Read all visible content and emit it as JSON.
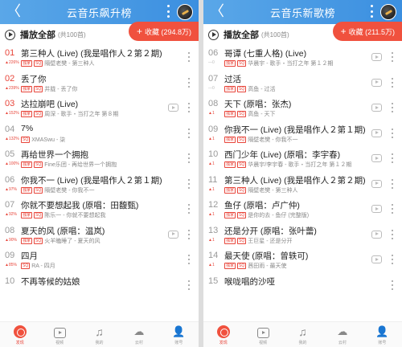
{
  "left": {
    "title": "云音乐飙升榜",
    "play_all": "播放全部",
    "count": "(共100首)",
    "collect": "收藏 (294.8万)",
    "rows": [
      {
        "rank": "01",
        "red": true,
        "trend": "▲226%",
        "title": "第三种人 (Live) (我是唱作人２第２期)",
        "tags": [
          "独家",
          "SQ"
        ],
        "sub": "隔壁老樊 - 第三种人",
        "mv": false
      },
      {
        "rank": "02",
        "red": true,
        "trend": "▲239%",
        "title": "丢了你",
        "tags": [
          "独家",
          "SQ"
        ],
        "sub": "井胧 - 丢了你",
        "mv": false
      },
      {
        "rank": "03",
        "red": true,
        "trend": "▲152%",
        "title": "达拉崩吧 (Live)",
        "tags": [
          "独家",
          "SQ"
        ],
        "sub": "周深 - 歌手・当打之年 第８期",
        "mv": true
      },
      {
        "rank": "04",
        "red": false,
        "trend": "▲132%",
        "title": "7%",
        "tags": [
          "SQ"
        ],
        "sub": "XMASwu - 柒",
        "mv": false
      },
      {
        "rank": "05",
        "red": false,
        "trend": "▲100%",
        "title": "再给世界一个拥抱",
        "tags": [
          "独家",
          "SQ"
        ],
        "sub": "Fine乐团 - 再给世界一个拥抱",
        "mv": false
      },
      {
        "rank": "06",
        "red": false,
        "trend": "▲97%",
        "title": "你我不一 (Live) (我是唱作人２第１期)",
        "tags": [
          "独家",
          "SQ"
        ],
        "sub": "隔壁老樊 - 你我不一",
        "mv": false
      },
      {
        "rank": "07",
        "red": false,
        "trend": "▲92%",
        "title": "你就不要想起我 (原唱：田馥甄)",
        "tags": [
          "独家",
          "SQ"
        ],
        "sub": "陈乐一 - 你就不要想起我",
        "mv": false
      },
      {
        "rank": "08",
        "red": false,
        "trend": "▲90%",
        "title": "夏天的风 (原唱：温岚)",
        "tags": [
          "独家",
          "SQ"
        ],
        "sub": "火羊瞌睡了 - 夏天的风",
        "mv": true
      },
      {
        "rank": "09",
        "red": false,
        "trend": "▲85%",
        "title": "四月",
        "tags": [
          "SQ"
        ],
        "sub": "RA - 四月",
        "mv": false
      },
      {
        "rank": "10",
        "red": false,
        "trend": "",
        "title": "不再等候的姑娘",
        "tags": [],
        "sub": "",
        "mv": false
      }
    ]
  },
  "right": {
    "title": "云音乐新歌榜",
    "play_all": "播放全部",
    "count": "(共100首)",
    "collect": "收藏 (211.5万)",
    "rows": [
      {
        "rank": "06",
        "red": false,
        "trend": "—0",
        "title": "哥谭 (七重人格) (Live)",
        "tags": [
          "独家",
          "SQ"
        ],
        "sub": "华晨宇 - 歌手・当打之年 第１２期",
        "mv": true
      },
      {
        "rank": "07",
        "red": false,
        "trend": "—0",
        "title": "过活",
        "tags": [
          "独家",
          "SQ"
        ],
        "sub": "高鱼 - 过活",
        "mv": true
      },
      {
        "rank": "08",
        "red": false,
        "trend": "▲1",
        "title": "天下 (原唱：张杰)",
        "tags": [
          "独家",
          "SQ"
        ],
        "sub": "高鱼 - 天下",
        "mv": true
      },
      {
        "rank": "09",
        "red": false,
        "trend": "▲1",
        "title": "你我不一 (Live) (我是唱作人２第１期)",
        "tags": [
          "独家",
          "SQ"
        ],
        "sub": "隔壁老樊 - 你我不一",
        "mv": true
      },
      {
        "rank": "10",
        "red": false,
        "trend": "▲1",
        "title": "西门少年 (Live) (原唱：李宇春)",
        "tags": [
          "独家",
          "SQ"
        ],
        "sub": "华晨宇/李宇春 - 歌手・当打之年 第１２期",
        "mv": true
      },
      {
        "rank": "11",
        "red": false,
        "trend": "▲1",
        "title": "第三种人 (Live) (我是唱作人２第２期)",
        "tags": [
          "独家",
          "SQ"
        ],
        "sub": "隔壁老樊 - 第三种人",
        "mv": true
      },
      {
        "rank": "12",
        "red": false,
        "trend": "▲1",
        "title": "鱼仔 (原唱：卢广仲)",
        "tags": [
          "独家",
          "SQ"
        ],
        "sub": "是你的去 - 鱼仔 (完整版)",
        "mv": true
      },
      {
        "rank": "13",
        "red": false,
        "trend": "▲1",
        "title": "还是分开 (原唱：张叶蕾)",
        "tags": [
          "独家",
          "SQ"
        ],
        "sub": "王巨星 - 还是分开",
        "mv": true
      },
      {
        "rank": "14",
        "red": false,
        "trend": "▲1",
        "title": "最天使 (原唱：曾轶可)",
        "tags": [
          "独家",
          "SQ"
        ],
        "sub": "茜田雨 - 最天使",
        "mv": true
      },
      {
        "rank": "15",
        "red": false,
        "trend": "",
        "title": "喉咙唱的沙哑",
        "tags": [],
        "sub": "",
        "mv": false
      }
    ]
  },
  "tabs": [
    "发现",
    "视频",
    "我的",
    "云村",
    "账号"
  ],
  "colors": {
    "accent": "#e8453a",
    "topbar": "#3b8fe0"
  }
}
